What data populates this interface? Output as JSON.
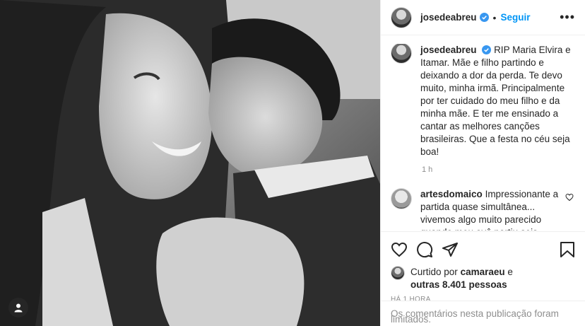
{
  "post": {
    "username": "josedeabreu",
    "follow_label": "Seguir",
    "more_label": "•••",
    "separator": "•"
  },
  "caption": {
    "username": "josedeabreu",
    "text": "RIP Maria Elvira e Itamar. Mãe e filho partindo e deixando a dor da perda. Te devo muito, minha irmã. Principalmente por ter cuidado do meu filho e da minha mãe. E ter me ensinado a cantar as melhores canções brasileiras. Que a festa no céu seja boa!",
    "time": "1 h"
  },
  "comment": {
    "username": "artesdomaico",
    "text": "Impressionante a partida quase simultânea... vivemos algo muito parecido quando meu avô partiu seis"
  },
  "likes": {
    "prefix": "Curtido por",
    "first_user": "camaraeu",
    "connector": "e",
    "others": "outras 8.401 pessoas"
  },
  "timestamp": "HÁ 1 HORA",
  "comments_limited": "Os comentários nesta publicação foram limitados.",
  "colors": {
    "accent": "#0095f6",
    "muted": "#8e8e8e",
    "text": "#262626"
  },
  "icons": [
    "user-tag-icon",
    "verified-icon",
    "heart-icon",
    "comment-icon",
    "share-icon",
    "save-icon"
  ]
}
